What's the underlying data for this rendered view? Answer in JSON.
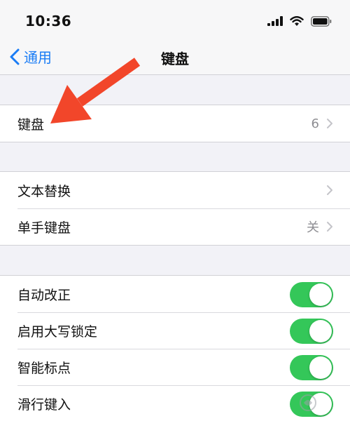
{
  "status_bar": {
    "time": "10:36"
  },
  "nav": {
    "back_label": "通用",
    "title": "键盘"
  },
  "sections": {
    "keyboards": {
      "label": "键盘",
      "value": "6"
    },
    "text_replacement": {
      "label": "文本替换"
    },
    "one_handed": {
      "label": "单手键盘",
      "value": "关"
    },
    "auto_correct": {
      "label": "自动改正",
      "on": true
    },
    "caps_lock": {
      "label": "启用大写锁定",
      "on": true
    },
    "smart_punct": {
      "label": "智能标点",
      "on": true
    },
    "slide_to_type": {
      "label": "滑行键入",
      "on": true
    }
  },
  "colors": {
    "accent": "#1a7cf5",
    "toggle_on": "#34c759",
    "arrow": "#f2462a"
  },
  "icons": [
    "signal-icon",
    "wifi-icon",
    "battery-icon",
    "back-chevron-icon",
    "chevron-right-icon"
  ]
}
